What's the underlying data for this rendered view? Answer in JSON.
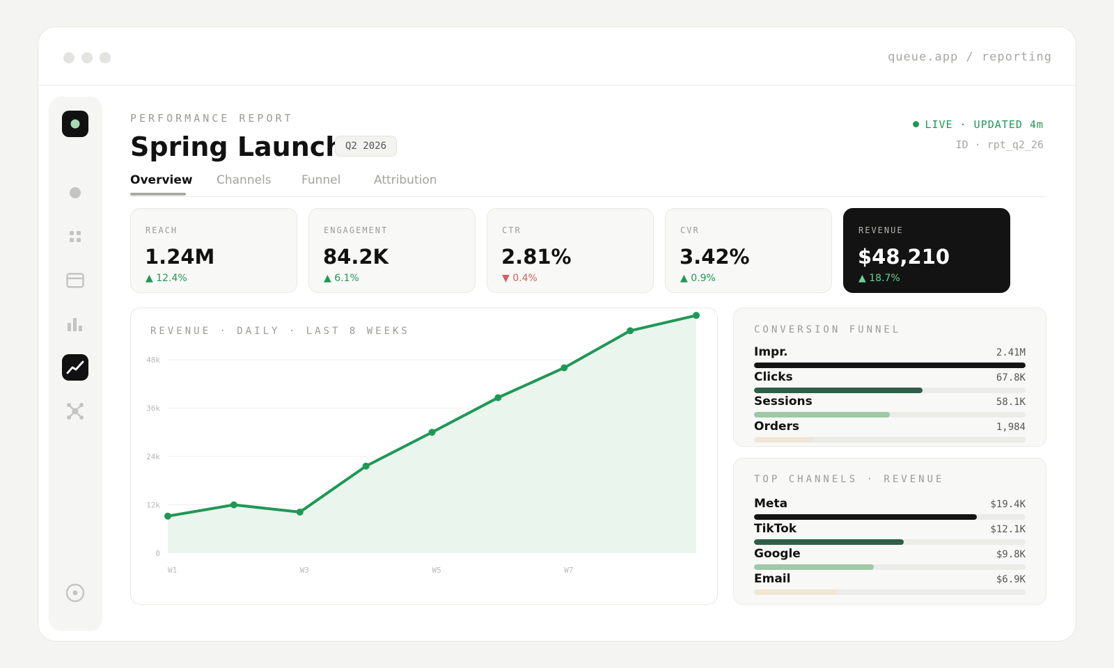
{
  "window": {
    "url": "queue.app / reporting"
  },
  "sidebar": {
    "items": [
      {
        "icon": "logo-icon",
        "active": true
      },
      {
        "icon": "circle-icon",
        "active": false
      },
      {
        "icon": "grid-icon",
        "active": false
      },
      {
        "icon": "card-icon",
        "active": false
      },
      {
        "icon": "bar-chart-icon",
        "active": false
      },
      {
        "icon": "trend-icon",
        "active": true
      },
      {
        "icon": "network-icon",
        "active": false
      },
      {
        "icon": "settings-icon",
        "active": false
      }
    ]
  },
  "header": {
    "eyebrow": "PERFORMANCE REPORT",
    "title": "Spring Launch",
    "badge": "Q2 2026",
    "live": "LIVE · UPDATED 4m",
    "report_id": "ID · rpt_q2_26"
  },
  "tabs": [
    "Overview",
    "Channels",
    "Funnel",
    "Attribution"
  ],
  "active_tab": "Overview",
  "kpis": [
    {
      "label": "REACH",
      "value": "1.24M",
      "delta": "▲ 12.4%",
      "trend": "up"
    },
    {
      "label": "ENGAGEMENT",
      "value": "84.2K",
      "delta": "▲ 6.1%",
      "trend": "up"
    },
    {
      "label": "CTR",
      "value": "2.81%",
      "delta": "▼ 0.4%",
      "trend": "down"
    },
    {
      "label": "CVR",
      "value": "3.42%",
      "delta": "▲ 0.9%",
      "trend": "up"
    },
    {
      "label": "REVENUE",
      "value": "$48,210",
      "delta": "▲ 18.7%",
      "trend": "up",
      "highlight": true
    }
  ],
  "chart_data": {
    "type": "area",
    "title": "REVENUE · DAILY · LAST 8 WEEKS",
    "x_tick_labels": [
      "W1",
      "W3",
      "W5",
      "W7"
    ],
    "y_tick_labels": [
      "0",
      "12k",
      "24k",
      "36k",
      "48k"
    ],
    "ylim": [
      0,
      48000
    ],
    "xlim": [
      0,
      8
    ],
    "x": [
      0,
      1,
      2,
      3,
      4,
      5,
      6,
      7,
      8
    ],
    "values": [
      9200,
      12000,
      10200,
      21600,
      30000,
      38600,
      46000,
      55200,
      59000
    ],
    "grid": true,
    "color": "#1f9856"
  },
  "funnel": {
    "title": "CONVERSION FUNNEL",
    "rows": [
      {
        "name": "Impr.",
        "value": "2.41M",
        "fraction": 1.0,
        "color": "#141414"
      },
      {
        "name": "Clicks",
        "value": "67.8K",
        "fraction": 0.62,
        "color": "#2e5e48"
      },
      {
        "name": "Sessions",
        "value": "58.1K",
        "fraction": 0.5,
        "color": "#9ec8a6"
      },
      {
        "name": "Orders",
        "value": "1,984",
        "fraction": 0.22,
        "color": "#f0e6d6"
      }
    ]
  },
  "channels": {
    "title": "TOP CHANNELS · REVENUE",
    "rows": [
      {
        "name": "Meta",
        "value": "$19.4K",
        "fraction": 0.82,
        "color": "#141414"
      },
      {
        "name": "TikTok",
        "value": "$12.1K",
        "fraction": 0.55,
        "color": "#2e5e48"
      },
      {
        "name": "Google",
        "value": "$9.8K",
        "fraction": 0.44,
        "color": "#9ec8a6"
      },
      {
        "name": "Email",
        "value": "$6.9K",
        "fraction": 0.3,
        "color": "#f0e6d6"
      }
    ]
  }
}
